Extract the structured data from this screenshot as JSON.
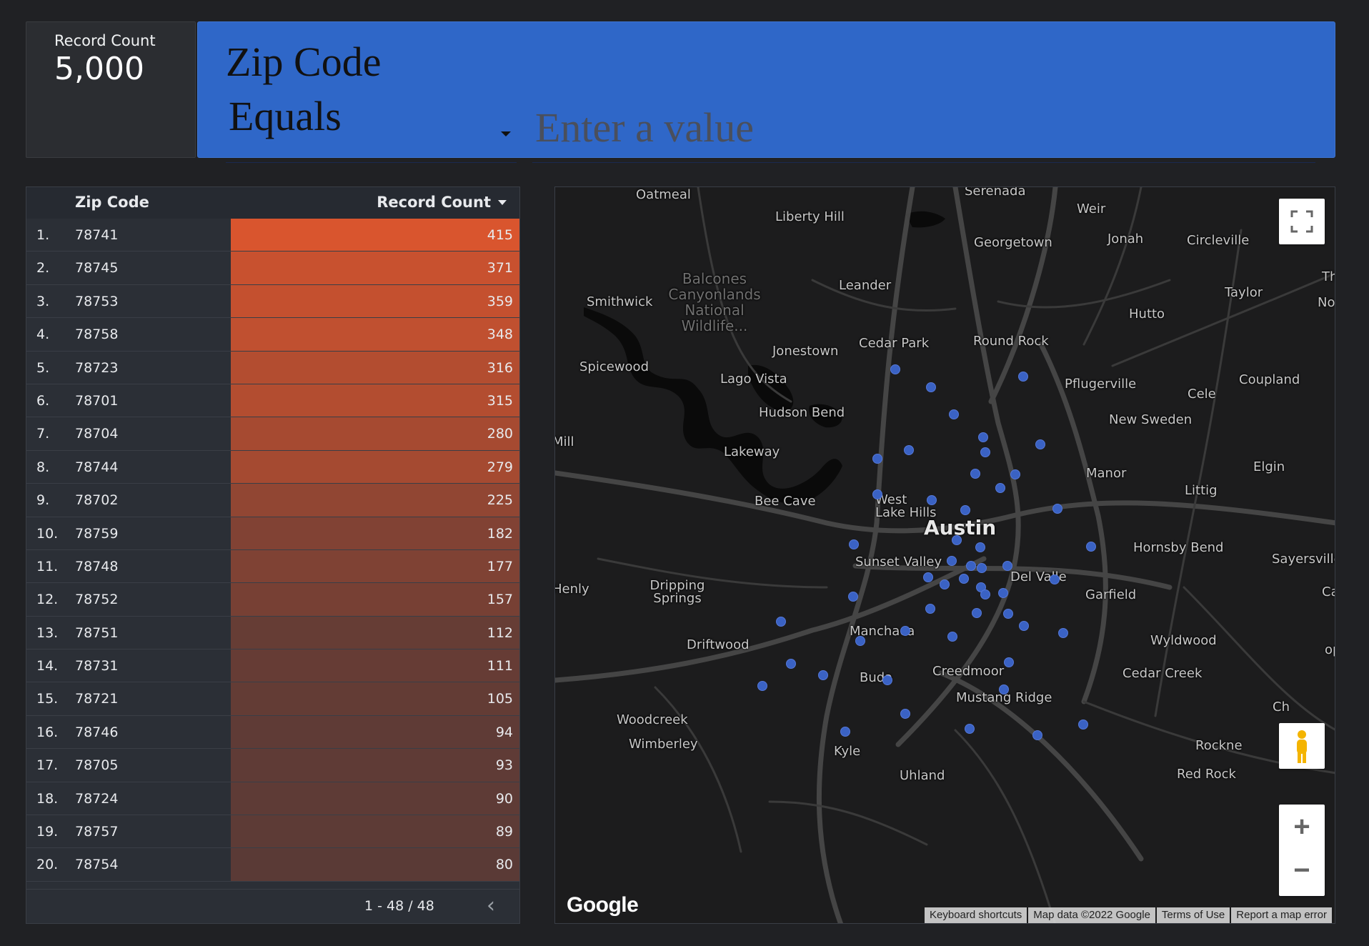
{
  "scorecard": {
    "label": "Record Count",
    "value": "5,000"
  },
  "filter": {
    "title": "Zip Code",
    "operator": "Equals",
    "placeholder": "Enter a value"
  },
  "table": {
    "header_zip": "Zip Code",
    "header_count": "Record Count",
    "bar_color_start": "#d9552e",
    "bar_color_end": "#5a3a36",
    "rows": [
      {
        "idx": "1.",
        "zip": "78741",
        "count": 415
      },
      {
        "idx": "2.",
        "zip": "78745",
        "count": 371
      },
      {
        "idx": "3.",
        "zip": "78753",
        "count": 359
      },
      {
        "idx": "4.",
        "zip": "78758",
        "count": 348
      },
      {
        "idx": "5.",
        "zip": "78723",
        "count": 316
      },
      {
        "idx": "6.",
        "zip": "78701",
        "count": 315
      },
      {
        "idx": "7.",
        "zip": "78704",
        "count": 280
      },
      {
        "idx": "8.",
        "zip": "78744",
        "count": 279
      },
      {
        "idx": "9.",
        "zip": "78702",
        "count": 225
      },
      {
        "idx": "10.",
        "zip": "78759",
        "count": 182
      },
      {
        "idx": "11.",
        "zip": "78748",
        "count": 177
      },
      {
        "idx": "12.",
        "zip": "78752",
        "count": 157
      },
      {
        "idx": "13.",
        "zip": "78751",
        "count": 112
      },
      {
        "idx": "14.",
        "zip": "78731",
        "count": 111
      },
      {
        "idx": "15.",
        "zip": "78721",
        "count": 105
      },
      {
        "idx": "16.",
        "zip": "78746",
        "count": 94
      },
      {
        "idx": "17.",
        "zip": "78705",
        "count": 93
      },
      {
        "idx": "18.",
        "zip": "78724",
        "count": 90
      },
      {
        "idx": "19.",
        "zip": "78757",
        "count": 89
      },
      {
        "idx": "20.",
        "zip": "78754",
        "count": 80
      }
    ],
    "pager": {
      "range": "1 - 48 / 48",
      "prev_icon": "chevron-left-icon",
      "next_icon": "chevron-right-icon"
    }
  },
  "map": {
    "places": [
      "Oatmeal",
      "Serenada",
      "Weir",
      "Liberty Hill",
      "Georgetown",
      "Jonah",
      "Circleville",
      "Thra",
      "Leander",
      "Taylor",
      "Noac",
      "Smithwick",
      "Hutto",
      "Cedar Park",
      "Round Rock",
      "Jonestown",
      "Spicewood",
      "Lago Vista",
      "Pflugerville",
      "Cele",
      "Coupland",
      "Hudson Bend",
      "New Sweden",
      "Mill",
      "Lakeway",
      "Manor",
      "Elgin",
      "Littig",
      "Bee Cave",
      "West Lake Hills",
      "Austin",
      "Hornsby Bend",
      "Sunset Valley",
      "Sayersville",
      "Del Valle",
      "Henly",
      "Dripping Springs",
      "Garfield",
      "Camp",
      "Manchaca",
      "Wyldwood",
      "Driftwood",
      "Creedmoor",
      "Cedar Creek",
      "Buda",
      "Mustang Ridge",
      "Woodcreek",
      "Wimberley",
      "Kyle",
      "Rockne",
      "Uhland",
      "Red Rock",
      "Ch",
      "op"
    ],
    "park_label": "Balcones Canyonlands National Wildlife...",
    "google_logo": "Google",
    "attribution": [
      "Keyboard shortcuts",
      "Map data ©2022 Google",
      "Terms of Use",
      "Report a map error"
    ],
    "marker_color": "#3a62c4",
    "controls": [
      "fullscreen-icon",
      "pegman-icon",
      "zoom-in-icon",
      "zoom-out-icon"
    ]
  }
}
